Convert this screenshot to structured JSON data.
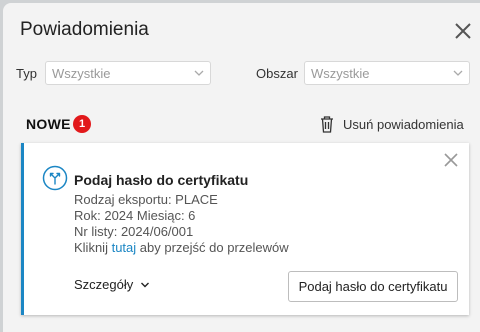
{
  "header": {
    "title": "Powiadomienia"
  },
  "filters": {
    "type": {
      "label": "Typ",
      "value": "Wszystkie"
    },
    "area": {
      "label": "Obszar",
      "value": "Wszystkie"
    }
  },
  "section": {
    "title": "NOWE",
    "count": "1",
    "delete_label": "Usuń powiadomienia"
  },
  "notification": {
    "title": "Podaj hasło do certyfikatu",
    "export_type": "Rodzaj eksportu: PLACE",
    "period": "Rok: 2024 Miesiąc: 6",
    "list_number": "Nr listy: 2024/06/001",
    "link_prefix": "Kliknij",
    "link_text": "tutaj",
    "link_suffix": "aby przejść do przelewów",
    "details_label": "Szczegóły",
    "action_label": "Podaj hasło do certyfikatu"
  },
  "colors": {
    "accent": "#1b86c4",
    "badge": "#e2191b"
  },
  "icons": {
    "close": "close-icon",
    "delete": "trash-icon",
    "notification": "merge-arrows-icon",
    "details": "chevron-down-icon"
  }
}
